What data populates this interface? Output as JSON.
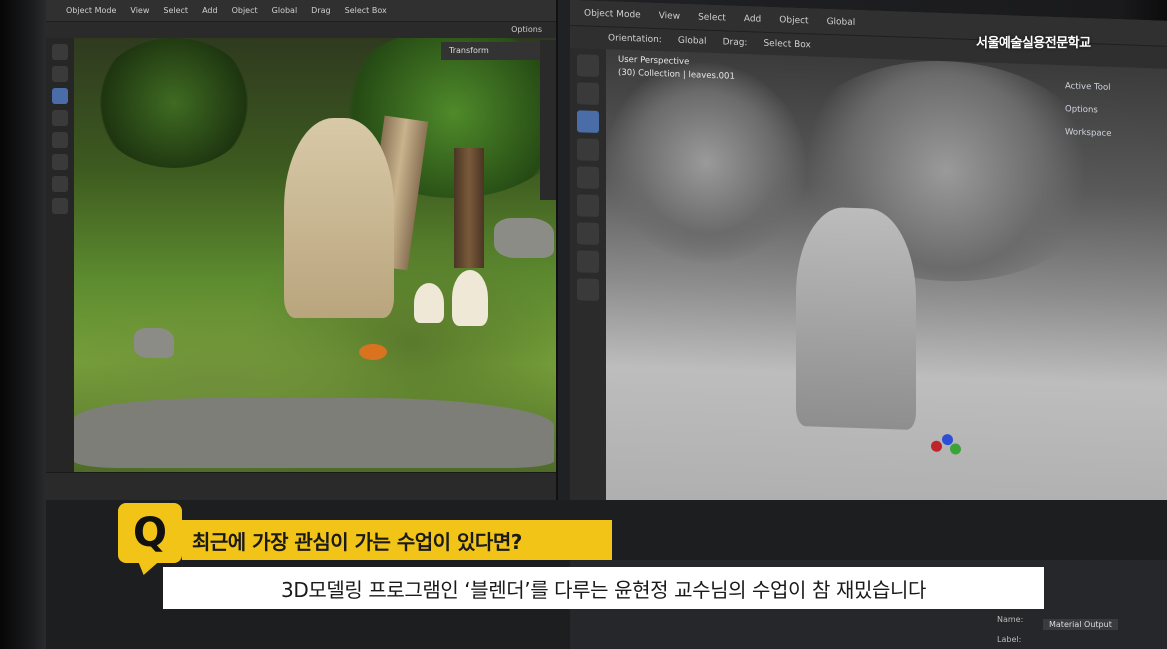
{
  "left_viewport": {
    "header": [
      "Object Mode",
      "View",
      "Select",
      "Add",
      "Object",
      "Global",
      "Drag",
      "Select Box"
    ],
    "options_label": "Options",
    "panel_title": "Transform"
  },
  "right_viewport": {
    "header": [
      "Object Mode",
      "View",
      "Select",
      "Add",
      "Object",
      "Global"
    ],
    "subheader": [
      "Orientation:",
      "Global",
      "Drag:",
      "Select Box"
    ],
    "info_line1": "User Perspective",
    "info_line2": "(30) Collection | leaves.001",
    "panel_items": [
      "Active Tool",
      "Options",
      "Workspace"
    ]
  },
  "node_editor": {
    "name_label": "Name:",
    "name_value": "Material Output",
    "label_label": "Label:"
  },
  "watermark": "서울예술실용전문학교",
  "subtitle": {
    "badge": "Q",
    "question": "최근에 가장 관심이 가는 수업이 있다면?",
    "answer": "3D모델링 프로그램인 ‘블렌더’를 다루는 윤현정 교수님의 수업이 참 재밌습니다"
  },
  "colors": {
    "badge_yellow": "#f2c418",
    "answer_bg": "#ffffff"
  }
}
